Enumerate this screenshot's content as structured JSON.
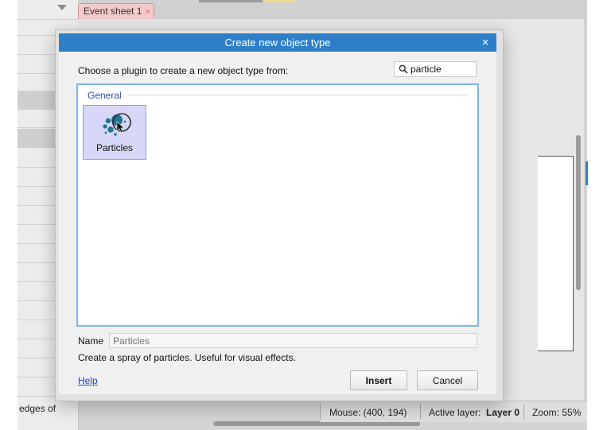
{
  "background": {
    "tab_label": "Event sheet 1",
    "tab_close": "×",
    "left_panel_text": "edges of",
    "status": {
      "mouse": "Mouse: (400, 194)",
      "active_layer_label": "Active layer:",
      "active_layer_value": "Layer 0",
      "zoom": "Zoom: 55%"
    }
  },
  "dialog": {
    "title": "Create new object type",
    "close_label": "×",
    "prompt": "Choose a plugin to create a new object type from:",
    "search": {
      "value": "particle",
      "icon": "search-icon"
    },
    "group_label": "General",
    "plugins": [
      {
        "label": "Particles",
        "icon": "particles-icon",
        "selected": true
      }
    ],
    "name_label": "Name",
    "name_placeholder": "Particles",
    "description": "Create a spray of particles. Useful for visual effects.",
    "help_label": "Help",
    "insert_label": "Insert",
    "cancel_label": "Cancel"
  },
  "colors": {
    "header_blue": "#2e7fc9",
    "list_border": "#7fb5ea",
    "tile_selected": "#d8d7f7",
    "group_text": "#2a4eb0",
    "link": "#1a45c8",
    "tab_pink": "#f3c9c9"
  }
}
